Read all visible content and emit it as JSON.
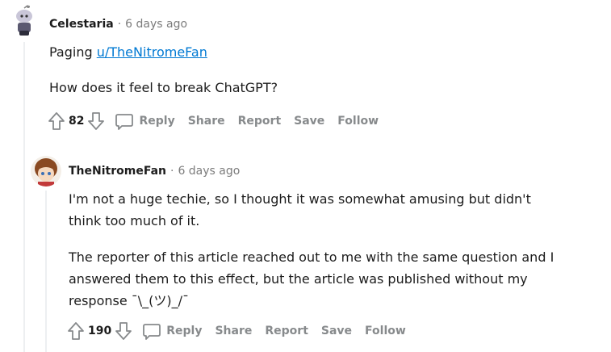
{
  "comments": [
    {
      "username": "Celestaria",
      "separator": "·",
      "time": "6 days ago",
      "body": {
        "paging_prefix": "Paging",
        "mention": "u/TheNitromeFan",
        "question": "How does it feel to break ChatGPT?"
      },
      "actions": {
        "votes": "82",
        "reply": "Reply",
        "share": "Share",
        "report": "Report",
        "save": "Save",
        "follow": "Follow"
      }
    },
    {
      "username": "TheNitromeFan",
      "separator": "·",
      "time": "6 days ago",
      "body": {
        "paragraph1": "I'm not a huge techie, so I thought it was somewhat amusing but didn't think too much of it.",
        "paragraph2": "The reporter of this article reached out to me with the same question and I answered them to this effect, but the article was published without my response ¯\\_(ツ)_/¯"
      },
      "actions": {
        "votes": "190",
        "reply": "Reply",
        "share": "Share",
        "report": "Report",
        "save": "Save",
        "follow": "Follow"
      }
    }
  ],
  "icons": {
    "upvote": "arrow-up-outline-icon",
    "downvote": "arrow-down-outline-icon",
    "reply": "speech-bubble-icon"
  },
  "colors": {
    "text": "#1c1c1c",
    "meta": "#7c7c7c",
    "action": "#878a8c",
    "link": "#0079d3",
    "threadline": "#edeff1"
  }
}
